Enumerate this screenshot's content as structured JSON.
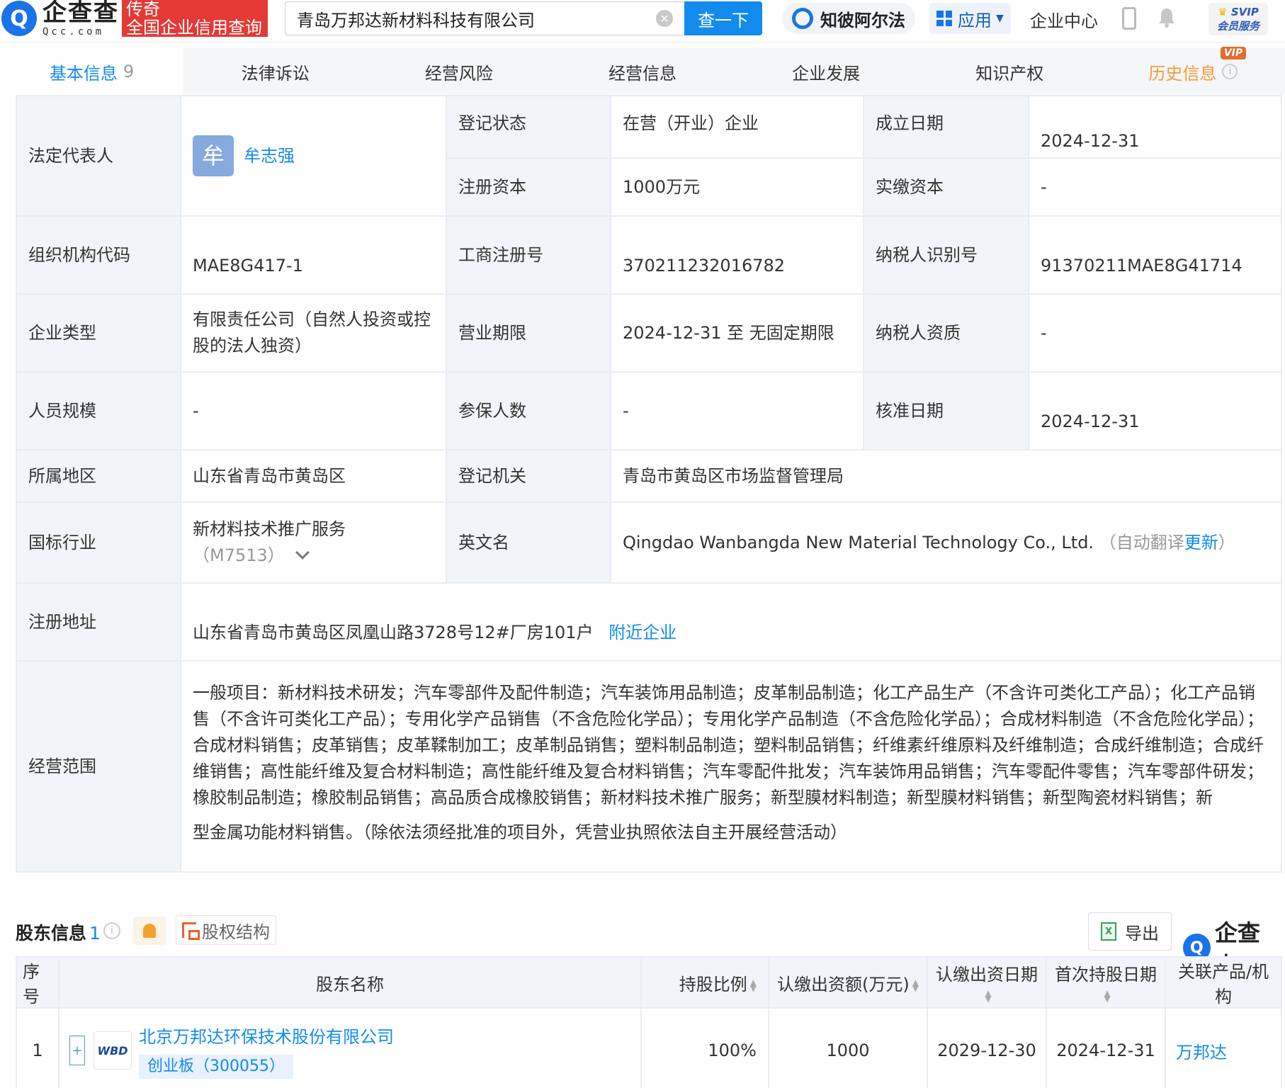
{
  "topbar": {
    "logo_cn": "企查查",
    "logo_en": "Qcc.com",
    "logo_tag_line1": "传奇",
    "logo_tag_line2": "全国企业信用查询",
    "search_value": "青岛万邦达新材料科技有限公司",
    "search_button": "查一下",
    "zhibi": "知彼阿尔法",
    "apps": "应用",
    "enterprise_center": "企业中心",
    "svip_line1": "SVIP",
    "svip_line2": "会员服务"
  },
  "tabs": [
    {
      "label": "基本信息",
      "count": "9"
    },
    {
      "label": "法律诉讼"
    },
    {
      "label": "经营风险"
    },
    {
      "label": "经营信息"
    },
    {
      "label": "企业发展"
    },
    {
      "label": "知识产权"
    },
    {
      "label": "历史信息",
      "badge": "VIP"
    }
  ],
  "basic": {
    "legal_rep_label": "法定代表人",
    "legal_rep_avatar": "牟",
    "legal_rep_name": "牟志强",
    "reg_status_label": "登记状态",
    "reg_status": "在营（开业）企业",
    "founded_label": "成立日期",
    "founded": "2024-12-31",
    "reg_capital_label": "注册资本",
    "reg_capital": "1000万元",
    "paid_capital_label": "实缴资本",
    "paid_capital": "-",
    "org_code_label": "组织机构代码",
    "org_code": "MAE8G417-1",
    "biz_reg_no_label": "工商注册号",
    "biz_reg_no": "370211232016782",
    "taxpayer_id_label": "纳税人识别号",
    "taxpayer_id": "91370211MAE8G41714",
    "company_type_label": "企业类型",
    "company_type": "有限责任公司（自然人投资或控股的法人独资）",
    "biz_term_label": "营业期限",
    "biz_term": "2024-12-31 至 无固定期限",
    "tax_qual_label": "纳税人资质",
    "tax_qual": "-",
    "staff_label": "人员规模",
    "staff": "-",
    "insured_label": "参保人数",
    "insured": "-",
    "approved_label": "核准日期",
    "approved": "2024-12-31",
    "region_label": "所属地区",
    "region": "山东省青岛市黄岛区",
    "authority_label": "登记机关",
    "authority": "青岛市黄岛区市场监督管理局",
    "industry_label": "国标行业",
    "industry": "新材料技术推广服务",
    "industry_code": "（M7513）",
    "english_name_label": "英文名",
    "english_name": "Qingdao Wanbangda New Material Technology Co., Ltd.",
    "english_name_note_open": "（自动翻译",
    "english_name_update": "更新",
    "english_name_note_close": "）",
    "address_label": "注册地址",
    "address": "山东省青岛市黄岛区凤凰山路3728号12#厂房101户",
    "nearby": "附近企业",
    "scope_label": "经营范围",
    "scope_part1": "一般项目：新材料技术研发；汽车零部件及配件制造；汽车装饰用品制造；皮革制品制造；化工产品生产（不含许可类化工产品）；化工产品销售（不含许可类化工产品）；专用化学产品销售（不含危险化学品）；专用化学产品制造（不含危险化学品）；合成材料制造（不含危险化学品）；合成材料销售；皮革销售；皮革鞣制加工；皮革制品销售；塑料制品制造；塑料制品销售；纤维素纤维原料及纤维制造；合成纤维制造；合成纤维销售；高性能纤维及复合材料制造；高性能纤维及复合材料销售；汽车零配件批发；汽车装饰用品销售；汽车零配件零售；汽车零部件研发；橡胶制品制造；橡胶制品销售；高品质合成橡胶销售；新材料技术推广服务；新型膜材料制造；新型膜材料销售；新型陶瓷材料销售；新",
    "scope_part2": "型金属功能材料销售。（除依法须经批准的项目外，凭营业执照依法自主开展经营活动）"
  },
  "shareholders": {
    "title": "股东信息",
    "count": "1",
    "structure": "股权结构",
    "export": "导出",
    "brand": "企查查",
    "columns": [
      "序号",
      "股东名称",
      "持股比例",
      "认缴出资额(万元)",
      "认缴出资日期",
      "首次持股日期",
      "关联产品/机构"
    ],
    "rows": [
      {
        "index": "1",
        "name": "北京万邦达环保技术股份有限公司",
        "logo": "WBD",
        "tag": "创业板（300055）",
        "ratio": "100%",
        "amount": "1000",
        "subscribe_date": "2029-12-30",
        "first_date": "2024-12-31",
        "product": "万邦达"
      }
    ]
  }
}
